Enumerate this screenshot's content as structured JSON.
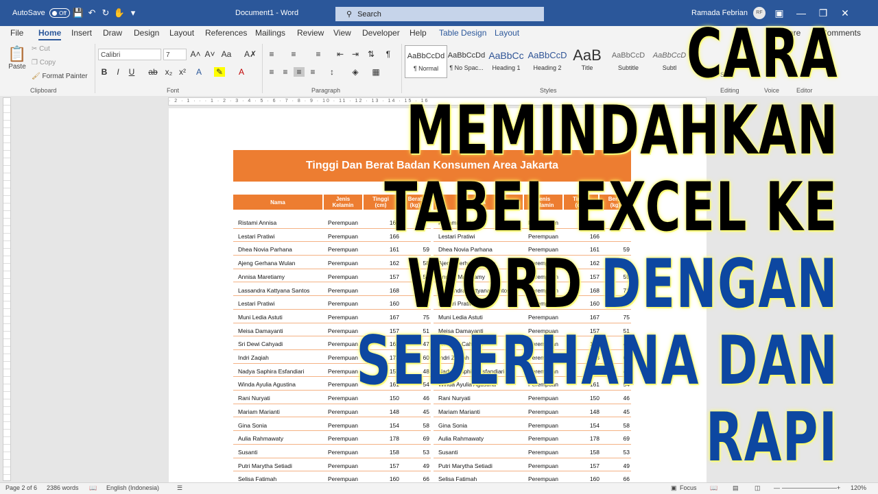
{
  "titlebar": {
    "autosave_label": "AutoSave",
    "autosave_state": "Off",
    "doc_title": "Document1 - Word",
    "search_placeholder": "Search",
    "user_name": "Ramada Febrian",
    "user_initials": "RF"
  },
  "menu": {
    "tabs": [
      "File",
      "Home",
      "Insert",
      "Draw",
      "Design",
      "Layout",
      "References",
      "Mailings",
      "Review",
      "View",
      "Developer",
      "Help",
      "Table Design",
      "Layout"
    ],
    "share_label": "are",
    "comments_label": "Comments"
  },
  "ribbon": {
    "clipboard": {
      "paste": "Paste",
      "cut": "Cut",
      "copy": "Copy",
      "format_painter": "Format Painter",
      "label": "Clipboard"
    },
    "font": {
      "name": "Calibri",
      "size": "7",
      "label": "Font"
    },
    "paragraph": {
      "label": "Paragraph"
    },
    "styles": {
      "label": "Styles",
      "items": [
        {
          "sample": "AaBbCcDd",
          "name": "¶ Normal"
        },
        {
          "sample": "AaBbCcDd",
          "name": "¶ No Spac..."
        },
        {
          "sample": "AaBbCc",
          "name": "Heading 1"
        },
        {
          "sample": "AaBbCcD",
          "name": "Heading 2"
        },
        {
          "sample": "AaB",
          "name": "Title"
        },
        {
          "sample": "AaBbCcD",
          "name": "Subtitle"
        },
        {
          "sample": "AaBbCcD",
          "name": "Subtl"
        }
      ]
    },
    "editing_label": "Editing",
    "editing_select": "Sele",
    "voice_label": "Voice",
    "editor_label": "Editor"
  },
  "document": {
    "table_title": "Tinggi Dan Berat Badan Konsumen Area Jakarta",
    "headers_left": [
      "Nama",
      "Jenis\nKelamin",
      "Tinggi\n(cm)",
      "Berat\n(kg)"
    ],
    "headers_right": [
      "Nama",
      "Jenis\nKelamin",
      "Tinggi\n(cm)",
      "Berat\n(kg)"
    ],
    "rows": [
      {
        "name": "Ristami Annisa",
        "gender": "Perempuan",
        "height": "160",
        "weight": ""
      },
      {
        "name": "Lestari Pratiwi",
        "gender": "Perempuan",
        "height": "166",
        "weight": ""
      },
      {
        "name": "Dhea Novia Parhana",
        "gender": "Perempuan",
        "height": "161",
        "weight": "59"
      },
      {
        "name": "Ajeng Gerhana Wulan",
        "gender": "Perempuan",
        "height": "162",
        "weight": "58"
      },
      {
        "name": "Annisa Maretiamy",
        "gender": "Perempuan",
        "height": "157",
        "weight": "59"
      },
      {
        "name": "Lassandra Kattyana Santos",
        "gender": "Perempuan",
        "height": "168",
        "weight": "71"
      },
      {
        "name": "Lestari Pratiwi",
        "gender": "Perempuan",
        "height": "160",
        "weight": "52"
      },
      {
        "name": "Muni Ledia Astuti",
        "gender": "Perempuan",
        "height": "167",
        "weight": "75"
      },
      {
        "name": "Meisa Damayanti",
        "gender": "Perempuan",
        "height": "157",
        "weight": "51"
      },
      {
        "name": "Sri Dewi Cahyadi",
        "gender": "Perempuan",
        "height": "162",
        "weight": "47"
      },
      {
        "name": "Indri Zaqiah",
        "gender": "Perempuan",
        "height": "173",
        "weight": "60"
      },
      {
        "name": "Nadya Saphira Esfandiari",
        "gender": "Perempuan",
        "height": "157",
        "weight": "48"
      },
      {
        "name": "Winda Ayulia Agustina",
        "gender": "Perempuan",
        "height": "161",
        "weight": "54"
      },
      {
        "name": "Rani Nuryati",
        "gender": "Perempuan",
        "height": "150",
        "weight": "46"
      },
      {
        "name": "Mariam Marianti",
        "gender": "Perempuan",
        "height": "148",
        "weight": "45"
      },
      {
        "name": "Gina Sonia",
        "gender": "Perempuan",
        "height": "154",
        "weight": "58"
      },
      {
        "name": "Aulia Rahmawaty",
        "gender": "Perempuan",
        "height": "178",
        "weight": "69"
      },
      {
        "name": "Susanti",
        "gender": "Perempuan",
        "height": "158",
        "weight": "53"
      },
      {
        "name": "Putri Marytha Setiadi",
        "gender": "Perempuan",
        "height": "157",
        "weight": "49"
      },
      {
        "name": "Selisa Fatimah",
        "gender": "Perempuan",
        "height": "160",
        "weight": "66"
      }
    ]
  },
  "overlay_text": {
    "line1": "CARA",
    "line2": "MEMINDAHKAN",
    "line3": "TABEL EXCEL KE",
    "line4_black": "WORD",
    "line4_blue": "DENGAN",
    "line5": "SEDERHANA DAN",
    "line6": "RAPI"
  },
  "status": {
    "page": "Page 2 of 6",
    "words": "2386 words",
    "language": "English (Indonesia)",
    "focus": "Focus",
    "zoom": "120%"
  }
}
